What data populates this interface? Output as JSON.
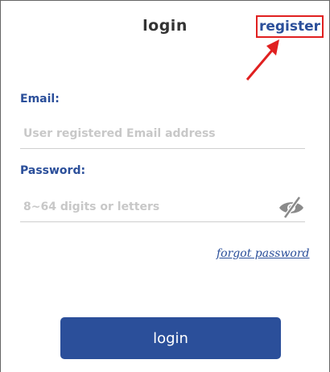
{
  "header": {
    "title": "login",
    "register_label": "register"
  },
  "form": {
    "email_label": "Email:",
    "email_placeholder": "User registered Email address",
    "password_label": "Password:",
    "password_placeholder": "8~64 digits or letters",
    "forgot_label": "forgot password",
    "login_label": "login"
  },
  "icons": {
    "visibility_toggle": "eye-off-icon",
    "annotation": "red-arrow-icon"
  },
  "colors": {
    "accent": "#2b4f9a",
    "annotation": "#e02020",
    "placeholder": "#c8c8c8"
  }
}
